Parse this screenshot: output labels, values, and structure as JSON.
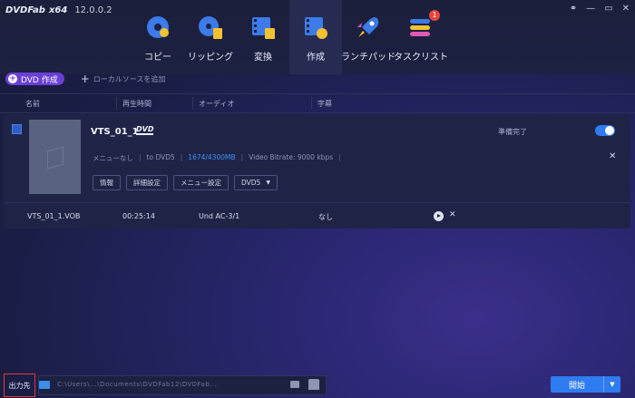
{
  "app": {
    "logo": "DVDFab",
    "edition": "x64",
    "version": "12.0.0.2"
  },
  "window_controls": [
    "⚭",
    "—",
    "▭",
    "✕"
  ],
  "nav": [
    {
      "label": "コピー",
      "icon": "disc-copy-icon",
      "active": false
    },
    {
      "label": "リッピング",
      "icon": "disc-rip-icon",
      "active": false
    },
    {
      "label": "変換",
      "icon": "film-convert-icon",
      "active": false
    },
    {
      "label": "作成",
      "icon": "film-create-icon",
      "active": true
    },
    {
      "label": "ランチパッド",
      "icon": "rocket-icon",
      "active": false
    },
    {
      "label": "タスクリスト",
      "icon": "tasklist-icon",
      "active": false,
      "badge": "1"
    }
  ],
  "toolbar": {
    "dvd_create_label": "DVD 作成",
    "add_local_label": "ローカルソースを追加"
  },
  "columns": [
    "名前",
    "再生時間",
    "オーディオ",
    "字幕"
  ],
  "item": {
    "title": "VTS_01_1",
    "format_logo": "DVD",
    "status": "準備完了",
    "info": [
      "メニューなし",
      "to DVD5",
      "1674/4300MB",
      "Video Bitrate: 9000 kbps"
    ],
    "buttons": [
      "情報",
      "詳細設定",
      "メニュー設定",
      "DVD5"
    ],
    "row": {
      "name": "VTS_01_1.VOB",
      "duration": "00:25:14",
      "audio": "Und AC-3/1",
      "subtitle": "なし"
    }
  },
  "bottom": {
    "output_label": "出力先",
    "path_text": "C:\\Users\\...\\Documents\\DVDFab12\\DVDFab...",
    "start_label": "開始"
  },
  "colors": {
    "accent": "#2f7bf0",
    "purple": "#6a3fd6",
    "highlight_red": "#e23a3a",
    "badge_red": "#e5453b"
  }
}
